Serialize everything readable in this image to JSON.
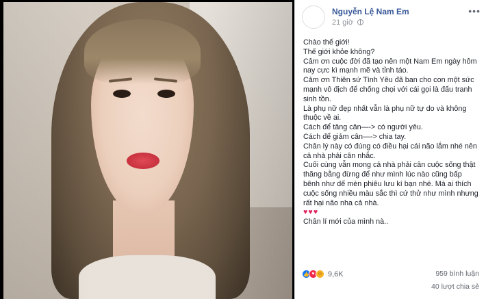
{
  "post": {
    "author": "Nguyễn Lệ Nam Em",
    "time": "21 giờ",
    "more_label": "•••",
    "lines": [
      "Chào thế giới!",
      "Thế giới khỏe không?",
      "Cảm ơn cuộc đời đã tạo nên một Nam Em ngày hôm nay cực kì mạnh mẽ và tỉnh táo.",
      "Cảm ơn Thiên sứ Tình Yêu đã ban cho con một sức mạnh vô địch để chống chọi với cái gọi là đấu tranh sinh tồn.",
      "Là phụ nữ đẹp nhất vẫn là phụ nữ tự do và không thuộc về ai.",
      "Cách để tăng cân—-> có người yêu.",
      "Cách để giảm cân—-> chia tay.",
      "Chân lý này có đúng có điều hại cái não lắm nhé nên cả nhà phải cân nhắc.",
      "Cuối cùng vẫn mong cả nhà phải cân cuộc sống thật thăng bằng đừng để như mình lúc nào cũng bấp bênh như dế mèn phiêu lưu kí bạn nhé. Mà ai thích cuộc sống nhiều màu sắc thì cứ thử như mình nhưng rất hại não nha cả nhà."
    ],
    "hearts": "♥♥♥",
    "last_line": "Chân lí mới của mình nà.."
  },
  "stats": {
    "reactions_count": "9,6K",
    "comments": "959 bình luận",
    "shares": "40 lượt chia sẻ"
  },
  "icons": {
    "like": "like-icon",
    "love": "love-icon",
    "haha": "haha-icon"
  },
  "colors": {
    "author": "#385898",
    "like": "#1877f2",
    "love": "#f0284a",
    "haha": "#f7b125"
  }
}
